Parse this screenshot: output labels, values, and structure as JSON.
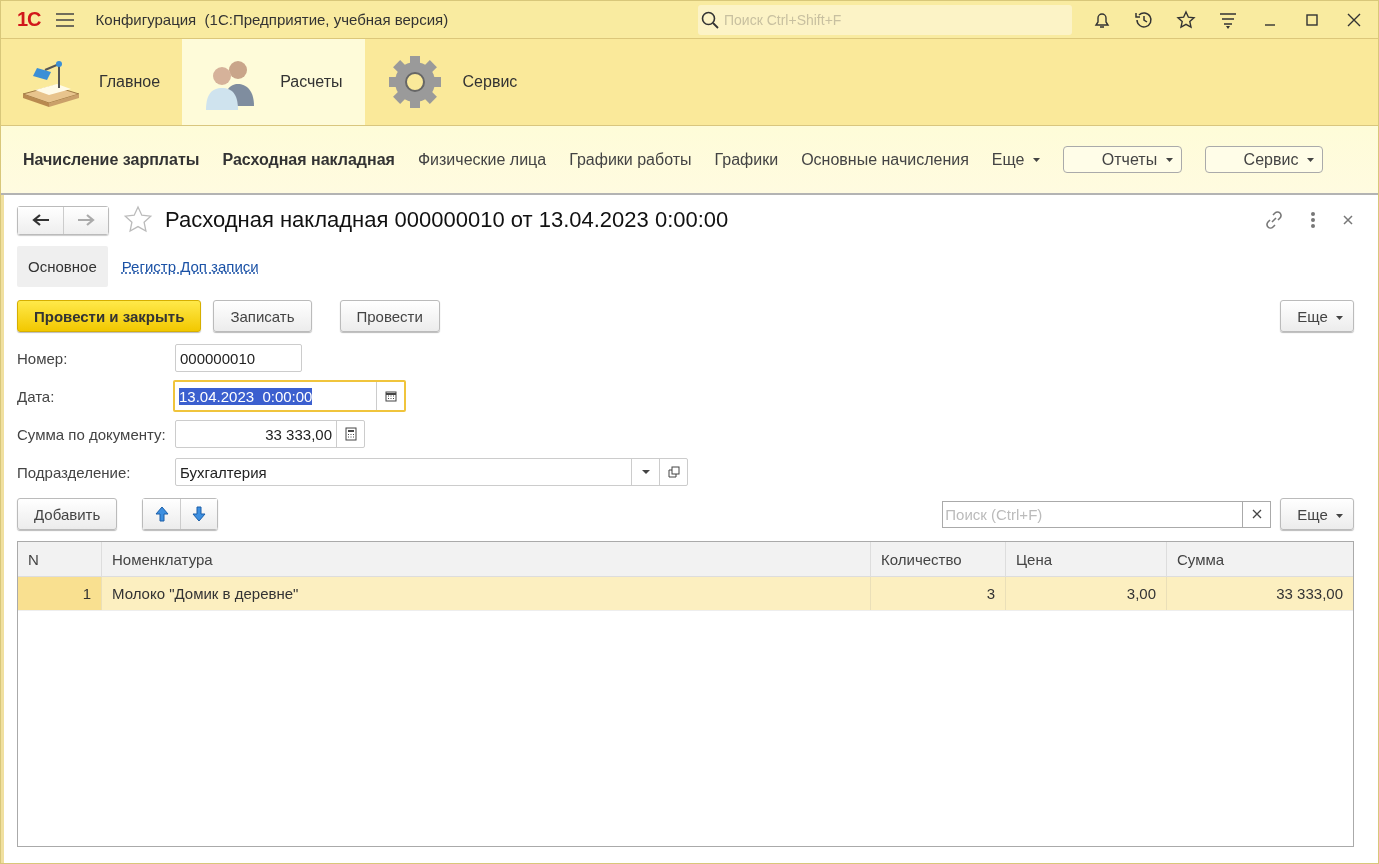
{
  "window": {
    "logo": "1С",
    "title": "Конфигурация  (1С:Предприятие, учебная версия)",
    "search": {
      "placeholder": "Поиск Ctrl+Shift+F"
    }
  },
  "sections": [
    {
      "label": "Главное",
      "kind": "desk",
      "selected": false
    },
    {
      "label": "Расчеты",
      "kind": "people",
      "selected": true
    },
    {
      "label": "Сервис",
      "kind": "gear",
      "selected": false
    }
  ],
  "commands": [
    {
      "label": "Начисление зарплаты",
      "kind": "link",
      "important": true
    },
    {
      "label": "Расходная накладная",
      "kind": "link",
      "important": true
    },
    {
      "label": "Физические лица",
      "kind": "link",
      "important": false
    },
    {
      "label": "Графики работы",
      "kind": "link",
      "important": false
    },
    {
      "label": "Графики",
      "kind": "link",
      "important": false
    },
    {
      "label": "Основные начисления",
      "kind": "link",
      "important": false
    },
    {
      "label": "Еще",
      "kind": "menu"
    },
    {
      "label": "Отчеты",
      "kind": "button"
    },
    {
      "label": "Сервис",
      "kind": "button"
    }
  ],
  "form": {
    "title": "Расходная накладная 000000010 от 13.04.2023 0:00:00",
    "tabs": [
      {
        "label": "Основное",
        "selected": true
      },
      {
        "label": "Регистр Доп записи",
        "selected": false
      }
    ],
    "buttons": [
      {
        "label": "Провести и закрыть",
        "default": true
      },
      {
        "label": "Записать",
        "default": false
      },
      {
        "label": "Провести",
        "default": false
      }
    ],
    "more": "Еще",
    "fields": [
      {
        "label": "Номер:",
        "value": "000000010",
        "kind": "text",
        "focused": false
      },
      {
        "label": "Дата:",
        "value": "13.04.2023  0:00:00",
        "kind": "date",
        "focused": true
      },
      {
        "label": "Сумма по документу:",
        "value": "33 333,00",
        "kind": "number",
        "focused": false
      },
      {
        "label": "Подразделение:",
        "value": "Бухгалтерия",
        "kind": "choice",
        "focused": false
      }
    ],
    "table_bar": {
      "add": "Добавить",
      "search": {
        "placeholder": "Поиск (Ctrl+F)"
      },
      "more": "Еще"
    },
    "table": {
      "columns": [
        {
          "label": "N",
          "kind": "number"
        },
        {
          "label": "Номенклатура",
          "kind": "text"
        },
        {
          "label": "Количество",
          "kind": "number"
        },
        {
          "label": "Цена",
          "kind": "number"
        },
        {
          "label": "Сумма",
          "kind": "number"
        }
      ],
      "rows": [
        {
          "cells": [
            "1",
            "Молоко \"Домик в деревне\"",
            "3",
            "3,00",
            "33 333,00"
          ],
          "selected": true
        }
      ]
    }
  }
}
